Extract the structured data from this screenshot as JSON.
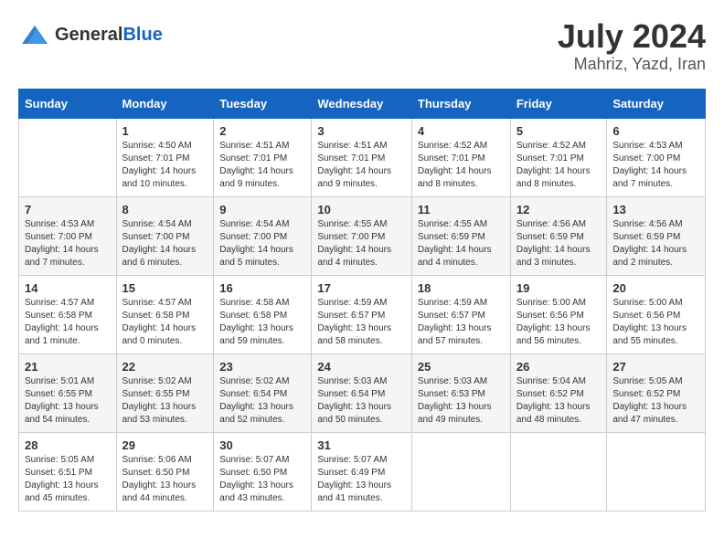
{
  "header": {
    "logo_general": "General",
    "logo_blue": "Blue",
    "month": "July 2024",
    "location": "Mahriz, Yazd, Iran"
  },
  "weekdays": [
    "Sunday",
    "Monday",
    "Tuesday",
    "Wednesday",
    "Thursday",
    "Friday",
    "Saturday"
  ],
  "weeks": [
    [
      {
        "day": "",
        "sunrise": "",
        "sunset": "",
        "daylight": ""
      },
      {
        "day": "1",
        "sunrise": "Sunrise: 4:50 AM",
        "sunset": "Sunset: 7:01 PM",
        "daylight": "Daylight: 14 hours and 10 minutes."
      },
      {
        "day": "2",
        "sunrise": "Sunrise: 4:51 AM",
        "sunset": "Sunset: 7:01 PM",
        "daylight": "Daylight: 14 hours and 9 minutes."
      },
      {
        "day": "3",
        "sunrise": "Sunrise: 4:51 AM",
        "sunset": "Sunset: 7:01 PM",
        "daylight": "Daylight: 14 hours and 9 minutes."
      },
      {
        "day": "4",
        "sunrise": "Sunrise: 4:52 AM",
        "sunset": "Sunset: 7:01 PM",
        "daylight": "Daylight: 14 hours and 8 minutes."
      },
      {
        "day": "5",
        "sunrise": "Sunrise: 4:52 AM",
        "sunset": "Sunset: 7:01 PM",
        "daylight": "Daylight: 14 hours and 8 minutes."
      },
      {
        "day": "6",
        "sunrise": "Sunrise: 4:53 AM",
        "sunset": "Sunset: 7:00 PM",
        "daylight": "Daylight: 14 hours and 7 minutes."
      }
    ],
    [
      {
        "day": "7",
        "sunrise": "Sunrise: 4:53 AM",
        "sunset": "Sunset: 7:00 PM",
        "daylight": "Daylight: 14 hours and 7 minutes."
      },
      {
        "day": "8",
        "sunrise": "Sunrise: 4:54 AM",
        "sunset": "Sunset: 7:00 PM",
        "daylight": "Daylight: 14 hours and 6 minutes."
      },
      {
        "day": "9",
        "sunrise": "Sunrise: 4:54 AM",
        "sunset": "Sunset: 7:00 PM",
        "daylight": "Daylight: 14 hours and 5 minutes."
      },
      {
        "day": "10",
        "sunrise": "Sunrise: 4:55 AM",
        "sunset": "Sunset: 7:00 PM",
        "daylight": "Daylight: 14 hours and 4 minutes."
      },
      {
        "day": "11",
        "sunrise": "Sunrise: 4:55 AM",
        "sunset": "Sunset: 6:59 PM",
        "daylight": "Daylight: 14 hours and 4 minutes."
      },
      {
        "day": "12",
        "sunrise": "Sunrise: 4:56 AM",
        "sunset": "Sunset: 6:59 PM",
        "daylight": "Daylight: 14 hours and 3 minutes."
      },
      {
        "day": "13",
        "sunrise": "Sunrise: 4:56 AM",
        "sunset": "Sunset: 6:59 PM",
        "daylight": "Daylight: 14 hours and 2 minutes."
      }
    ],
    [
      {
        "day": "14",
        "sunrise": "Sunrise: 4:57 AM",
        "sunset": "Sunset: 6:58 PM",
        "daylight": "Daylight: 14 hours and 1 minute."
      },
      {
        "day": "15",
        "sunrise": "Sunrise: 4:57 AM",
        "sunset": "Sunset: 6:58 PM",
        "daylight": "Daylight: 14 hours and 0 minutes."
      },
      {
        "day": "16",
        "sunrise": "Sunrise: 4:58 AM",
        "sunset": "Sunset: 6:58 PM",
        "daylight": "Daylight: 13 hours and 59 minutes."
      },
      {
        "day": "17",
        "sunrise": "Sunrise: 4:59 AM",
        "sunset": "Sunset: 6:57 PM",
        "daylight": "Daylight: 13 hours and 58 minutes."
      },
      {
        "day": "18",
        "sunrise": "Sunrise: 4:59 AM",
        "sunset": "Sunset: 6:57 PM",
        "daylight": "Daylight: 13 hours and 57 minutes."
      },
      {
        "day": "19",
        "sunrise": "Sunrise: 5:00 AM",
        "sunset": "Sunset: 6:56 PM",
        "daylight": "Daylight: 13 hours and 56 minutes."
      },
      {
        "day": "20",
        "sunrise": "Sunrise: 5:00 AM",
        "sunset": "Sunset: 6:56 PM",
        "daylight": "Daylight: 13 hours and 55 minutes."
      }
    ],
    [
      {
        "day": "21",
        "sunrise": "Sunrise: 5:01 AM",
        "sunset": "Sunset: 6:55 PM",
        "daylight": "Daylight: 13 hours and 54 minutes."
      },
      {
        "day": "22",
        "sunrise": "Sunrise: 5:02 AM",
        "sunset": "Sunset: 6:55 PM",
        "daylight": "Daylight: 13 hours and 53 minutes."
      },
      {
        "day": "23",
        "sunrise": "Sunrise: 5:02 AM",
        "sunset": "Sunset: 6:54 PM",
        "daylight": "Daylight: 13 hours and 52 minutes."
      },
      {
        "day": "24",
        "sunrise": "Sunrise: 5:03 AM",
        "sunset": "Sunset: 6:54 PM",
        "daylight": "Daylight: 13 hours and 50 minutes."
      },
      {
        "day": "25",
        "sunrise": "Sunrise: 5:03 AM",
        "sunset": "Sunset: 6:53 PM",
        "daylight": "Daylight: 13 hours and 49 minutes."
      },
      {
        "day": "26",
        "sunrise": "Sunrise: 5:04 AM",
        "sunset": "Sunset: 6:52 PM",
        "daylight": "Daylight: 13 hours and 48 minutes."
      },
      {
        "day": "27",
        "sunrise": "Sunrise: 5:05 AM",
        "sunset": "Sunset: 6:52 PM",
        "daylight": "Daylight: 13 hours and 47 minutes."
      }
    ],
    [
      {
        "day": "28",
        "sunrise": "Sunrise: 5:05 AM",
        "sunset": "Sunset: 6:51 PM",
        "daylight": "Daylight: 13 hours and 45 minutes."
      },
      {
        "day": "29",
        "sunrise": "Sunrise: 5:06 AM",
        "sunset": "Sunset: 6:50 PM",
        "daylight": "Daylight: 13 hours and 44 minutes."
      },
      {
        "day": "30",
        "sunrise": "Sunrise: 5:07 AM",
        "sunset": "Sunset: 6:50 PM",
        "daylight": "Daylight: 13 hours and 43 minutes."
      },
      {
        "day": "31",
        "sunrise": "Sunrise: 5:07 AM",
        "sunset": "Sunset: 6:49 PM",
        "daylight": "Daylight: 13 hours and 41 minutes."
      },
      {
        "day": "",
        "sunrise": "",
        "sunset": "",
        "daylight": ""
      },
      {
        "day": "",
        "sunrise": "",
        "sunset": "",
        "daylight": ""
      },
      {
        "day": "",
        "sunrise": "",
        "sunset": "",
        "daylight": ""
      }
    ]
  ]
}
